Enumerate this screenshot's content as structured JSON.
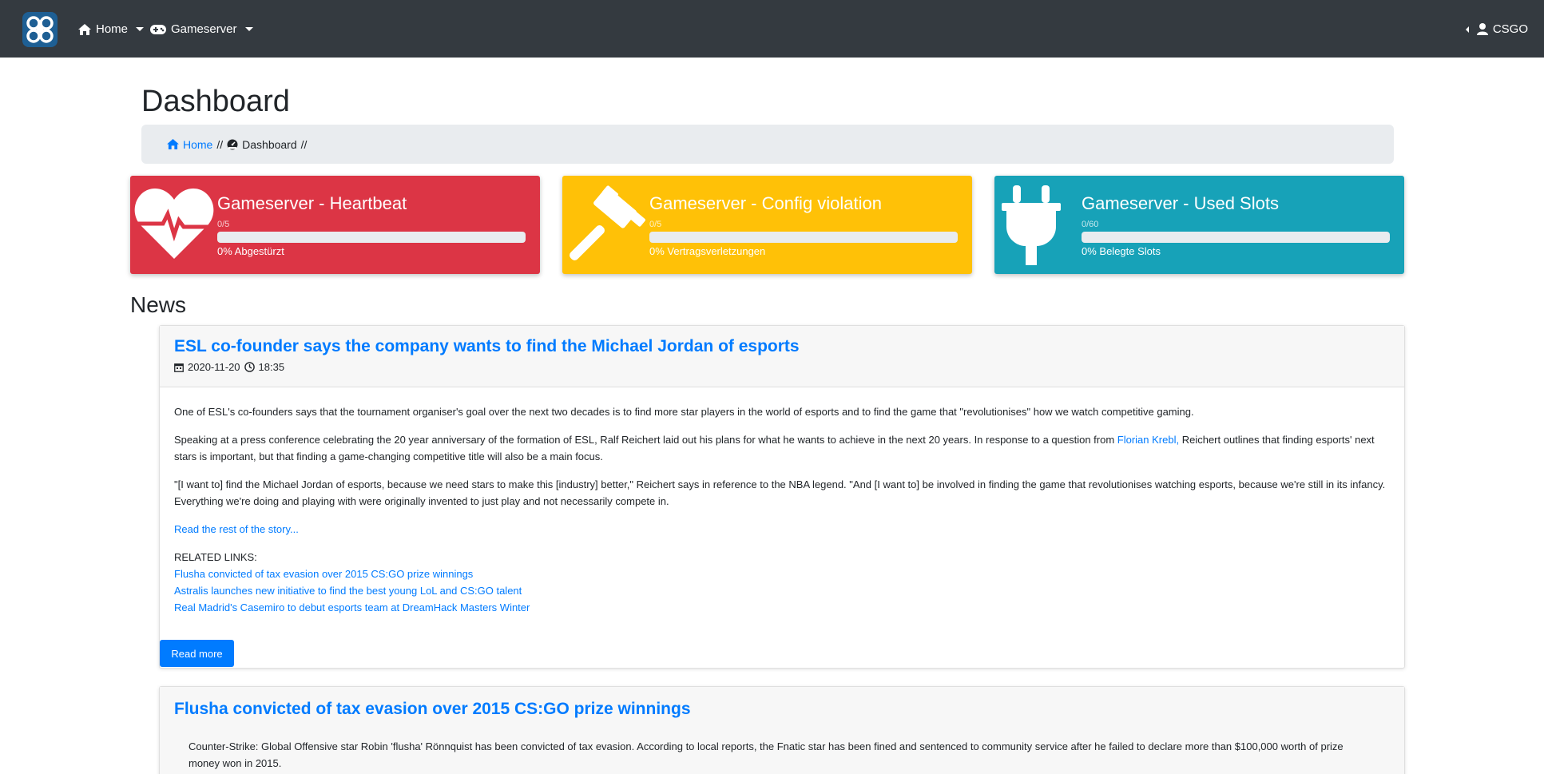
{
  "colors": {
    "navbar": "#343a40",
    "primary": "#007bff",
    "danger": "#dc3545",
    "warning": "#ffc107",
    "info": "#17a2b8"
  },
  "navbar": {
    "logo_icon": "app-logo-icon",
    "home_label": "Home",
    "gameserver_label": "Gameserver",
    "user_label": "CSGO"
  },
  "page": {
    "title": "Dashboard"
  },
  "breadcrumb": {
    "home": "Home",
    "separator": "//",
    "current": "Dashboard"
  },
  "stats": [
    {
      "title": "Gameserver - Heartbeat",
      "count": "0/5",
      "progress_percent": 0,
      "desc": "0% Abgestürzt",
      "icon": "heartbeat-icon",
      "color": "#dc3545"
    },
    {
      "title": "Gameserver - Config violation",
      "count": "0/5",
      "progress_percent": 0,
      "desc": "0% Vertragsverletzungen",
      "icon": "gavel-icon",
      "color": "#ffc107"
    },
    {
      "title": "Gameserver - Used Slots",
      "count": "0/60",
      "progress_percent": 0,
      "desc": "0% Belegte Slots",
      "icon": "plug-icon",
      "color": "#17a2b8"
    }
  ],
  "news": {
    "heading": "News",
    "articles": [
      {
        "title": "ESL co-founder says the company wants to find the Michael Jordan of esports",
        "date": "2020-11-20",
        "time": "18:35",
        "p1": "One of ESL's co-founders says that the tournament organiser's goal over the next two decades is to find more star players in the world of esports and to find the game that \"revolutionises\" how we watch competitive gaming.",
        "p2_before": "Speaking at a press conference celebrating the 20 year anniversary of the formation of ESL, Ralf Reichert laid out his plans for what he wants to achieve in the next 20 years. In response to a question from ",
        "p2_link": "Florian Krebl,",
        "p2_after": " Reichert outlines that finding esports' next stars is important, but that finding a game-changing competitive title will also be a main focus.",
        "p3": "\"[I want to] find the Michael Jordan of esports, because we need stars to make this [industry] better,\" Reichert says in reference to the NBA legend. \"And [I want to] be involved in finding the game that revolutionises watching esports, because we're still in its infancy. Everything we're doing and playing with were originally invented to just play and not necessarily compete in.",
        "read_rest": "Read the rest of the story...",
        "related_heading": "RELATED LINKS:",
        "related": [
          "Flusha convicted of tax evasion over 2015 CS:GO prize winnings",
          "Astralis launches new initiative to find the best young LoL and CS:GO talent",
          "Real Madrid's Casemiro to debut esports team at DreamHack Masters Winter"
        ],
        "read_more": "Read more"
      },
      {
        "title": "Flusha convicted of tax evasion over 2015 CS:GO prize winnings",
        "p1": "Counter-Strike: Global Offensive star Robin 'flusha' Rönnquist has been convicted of tax evasion. According to local reports, the Fnatic star has been fined and sentenced to community service after he failed to declare more than $100,000 worth of prize money won in 2015."
      }
    ]
  }
}
